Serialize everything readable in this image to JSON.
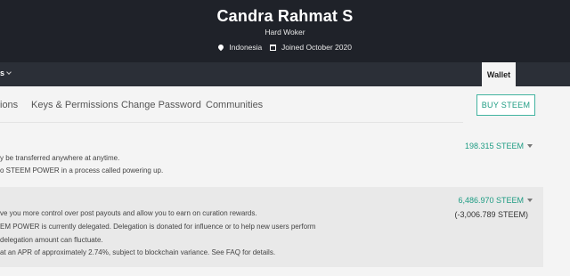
{
  "profile": {
    "name": "Candra Rahmat S",
    "about": "Hard Woker",
    "location": "Indonesia",
    "joined": "Joined October 2020"
  },
  "nav": {
    "left_label": "s",
    "wallet_label": "Wallet"
  },
  "tabs": [
    {
      "label": "ions"
    },
    {
      "label": "Keys & Permissions"
    },
    {
      "label": "Change Password"
    },
    {
      "label": "Communities"
    }
  ],
  "buy_button": "BUY STEEM",
  "steem_row": {
    "desc_lines": [
      "y be transferred anywhere at anytime.",
      "o STEEM POWER in a process called powering up."
    ],
    "amount": "198.315 STEEM"
  },
  "sp_row": {
    "desc_lines": [
      "ve you more control over post payouts and allow you to earn on curation rewards.",
      "EM POWER is currently delegated. Delegation is donated for influence or to help new users perform",
      "delegation amount can fluctuate.",
      "at an APR of approximately 2.74%, subject to blockchain variance. See FAQ for details."
    ],
    "amount": "6,486.970 STEEM",
    "delegated": "(-3,006.789 STEEM)"
  },
  "colors": {
    "accent": "#1e9c83",
    "header_bg": "#1f2229",
    "nav_bg": "#2b2f37"
  }
}
